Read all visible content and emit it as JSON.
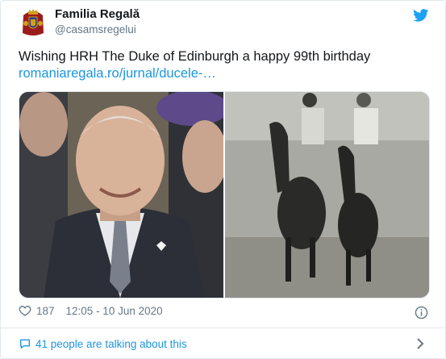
{
  "author": {
    "display_name": "Familia Regală",
    "handle": "@casamsregelui"
  },
  "tweet": {
    "text": "Wishing HRH The Duke of Edinburgh a happy 99th birthday",
    "link": "romaniaregala.ro/jurnal/ducele-…"
  },
  "stats": {
    "likes": "187",
    "timestamp": "12:05 - 10 Jun 2020"
  },
  "footer": {
    "conversation": "41 people are talking about this"
  },
  "icons": {
    "platform": "twitter-bird-icon",
    "like": "heart-icon",
    "info": "info-icon",
    "conversation": "speech-bubble-icon",
    "expand": "chevron-right-icon"
  },
  "colors": {
    "brand": "#1da1f2",
    "link": "#1b95e0",
    "secondary_text": "#657786"
  }
}
